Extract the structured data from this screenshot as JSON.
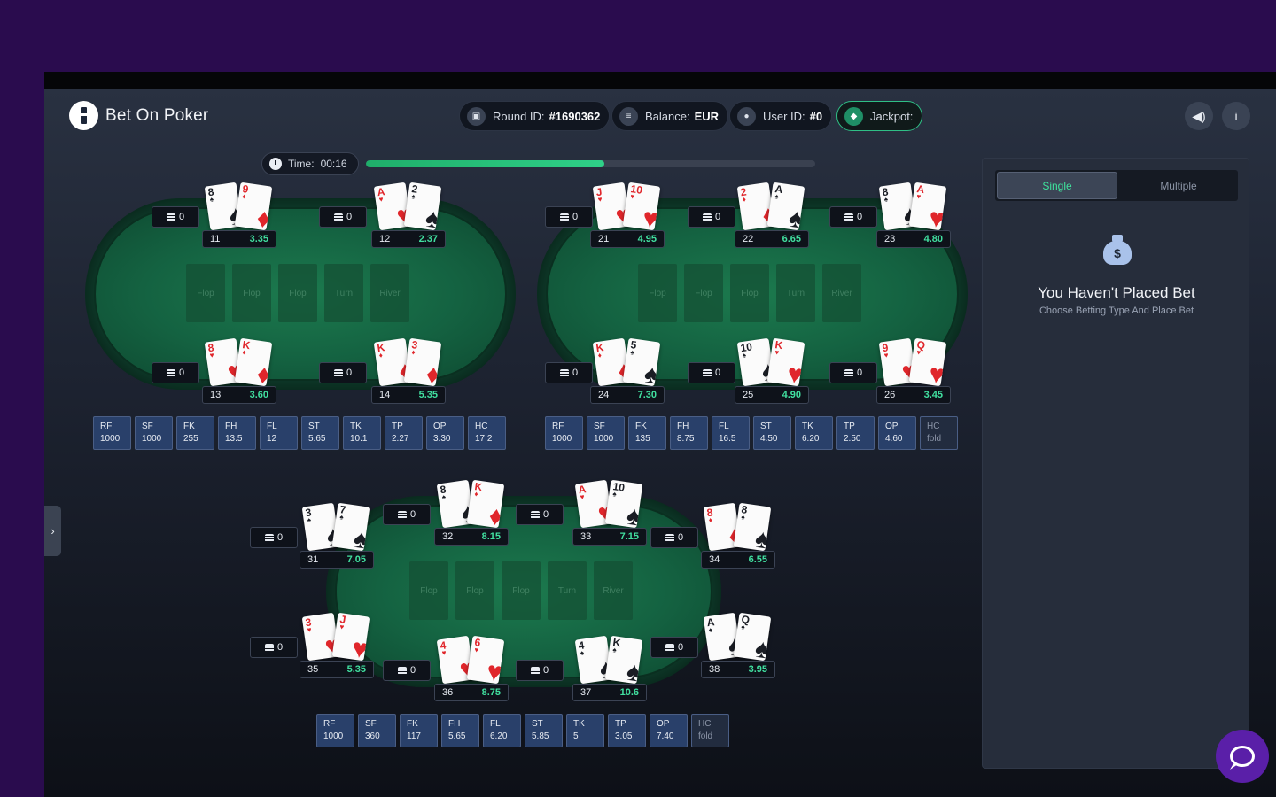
{
  "header": {
    "app_name": "Bet On Poker",
    "round_label": "Round ID:",
    "round_value": "#1690362",
    "balance_label": "Balance:",
    "balance_value": "EUR",
    "user_label": "User ID:",
    "user_value": "#0",
    "jackpot_label": "Jackpot:",
    "sound_icon": "speaker-icon",
    "info_icon": "info-icon"
  },
  "timer": {
    "label": "Time:",
    "value": "00:16",
    "progress_fraction": 0.53
  },
  "slot_labels": [
    "Flop",
    "Flop",
    "Flop",
    "Turn",
    "River"
  ],
  "colors": {
    "accent": "#3fe29d",
    "felt": "#146241",
    "odds_box": "#29406a",
    "brand_bg": "#2a0c4e",
    "chat": "#5a1fa8"
  },
  "tables": [
    {
      "players": [
        {
          "seat": "11",
          "odds": "3.35",
          "chips": "0",
          "cards": [
            {
              "rank": "8",
              "suit": "♠",
              "color": "black"
            },
            {
              "rank": "9",
              "suit": "♦",
              "color": "red"
            }
          ]
        },
        {
          "seat": "12",
          "odds": "2.37",
          "chips": "0",
          "cards": [
            {
              "rank": "A",
              "suit": "♥",
              "color": "red"
            },
            {
              "rank": "2",
              "suit": "♠",
              "color": "black"
            }
          ]
        },
        {
          "seat": "13",
          "odds": "3.60",
          "chips": "0",
          "cards": [
            {
              "rank": "8",
              "suit": "♥",
              "color": "red"
            },
            {
              "rank": "K",
              "suit": "♦",
              "color": "red"
            }
          ]
        },
        {
          "seat": "14",
          "odds": "5.35",
          "chips": "0",
          "cards": [
            {
              "rank": "K",
              "suit": "♦",
              "color": "red"
            },
            {
              "rank": "3",
              "suit": "♦",
              "color": "red"
            }
          ]
        }
      ],
      "odds": [
        {
          "code": "RF",
          "value": "1000"
        },
        {
          "code": "SF",
          "value": "1000"
        },
        {
          "code": "FK",
          "value": "255"
        },
        {
          "code": "FH",
          "value": "13.5"
        },
        {
          "code": "FL",
          "value": "12"
        },
        {
          "code": "ST",
          "value": "5.65"
        },
        {
          "code": "TK",
          "value": "10.1"
        },
        {
          "code": "TP",
          "value": "2.27"
        },
        {
          "code": "OP",
          "value": "3.30"
        },
        {
          "code": "HC",
          "value": "17.2"
        }
      ]
    },
    {
      "players": [
        {
          "seat": "21",
          "odds": "4.95",
          "chips": "0",
          "cards": [
            {
              "rank": "J",
              "suit": "♥",
              "color": "red"
            },
            {
              "rank": "10",
              "suit": "♥",
              "color": "red"
            }
          ]
        },
        {
          "seat": "22",
          "odds": "6.65",
          "chips": "0",
          "cards": [
            {
              "rank": "2",
              "suit": "♦",
              "color": "red"
            },
            {
              "rank": "A",
              "suit": "♠",
              "color": "black"
            }
          ]
        },
        {
          "seat": "23",
          "odds": "4.80",
          "chips": "0",
          "cards": [
            {
              "rank": "8",
              "suit": "♠",
              "color": "black"
            },
            {
              "rank": "A",
              "suit": "♥",
              "color": "red"
            }
          ]
        },
        {
          "seat": "24",
          "odds": "7.30",
          "chips": "0",
          "cards": [
            {
              "rank": "K",
              "suit": "♦",
              "color": "red"
            },
            {
              "rank": "5",
              "suit": "♠",
              "color": "black"
            }
          ]
        },
        {
          "seat": "25",
          "odds": "4.90",
          "chips": "0",
          "cards": [
            {
              "rank": "10",
              "suit": "♠",
              "color": "black"
            },
            {
              "rank": "K",
              "suit": "♥",
              "color": "red"
            }
          ]
        },
        {
          "seat": "26",
          "odds": "3.45",
          "chips": "0",
          "cards": [
            {
              "rank": "9",
              "suit": "♥",
              "color": "red"
            },
            {
              "rank": "Q",
              "suit": "♥",
              "color": "red"
            }
          ]
        }
      ],
      "odds": [
        {
          "code": "RF",
          "value": "1000"
        },
        {
          "code": "SF",
          "value": "1000"
        },
        {
          "code": "FK",
          "value": "135"
        },
        {
          "code": "FH",
          "value": "8.75"
        },
        {
          "code": "FL",
          "value": "16.5"
        },
        {
          "code": "ST",
          "value": "4.50"
        },
        {
          "code": "TK",
          "value": "6.20"
        },
        {
          "code": "TP",
          "value": "2.50"
        },
        {
          "code": "OP",
          "value": "4.60"
        },
        {
          "code": "HC",
          "value": "fold"
        }
      ]
    },
    {
      "players": [
        {
          "seat": "31",
          "odds": "7.05",
          "chips": "0",
          "cards": [
            {
              "rank": "3",
              "suit": "♠",
              "color": "black"
            },
            {
              "rank": "7",
              "suit": "♠",
              "color": "black"
            }
          ]
        },
        {
          "seat": "32",
          "odds": "8.15",
          "chips": "0",
          "cards": [
            {
              "rank": "8",
              "suit": "♠",
              "color": "black"
            },
            {
              "rank": "K",
              "suit": "♦",
              "color": "red"
            }
          ]
        },
        {
          "seat": "33",
          "odds": "7.15",
          "chips": "0",
          "cards": [
            {
              "rank": "A",
              "suit": "♥",
              "color": "red"
            },
            {
              "rank": "10",
              "suit": "♠",
              "color": "black"
            }
          ]
        },
        {
          "seat": "34",
          "odds": "6.55",
          "chips": "0",
          "cards": [
            {
              "rank": "8",
              "suit": "♦",
              "color": "red"
            },
            {
              "rank": "8",
              "suit": "♠",
              "color": "black"
            }
          ]
        },
        {
          "seat": "35",
          "odds": "5.35",
          "chips": "0",
          "cards": [
            {
              "rank": "3",
              "suit": "♥",
              "color": "red"
            },
            {
              "rank": "J",
              "suit": "♥",
              "color": "red"
            }
          ]
        },
        {
          "seat": "36",
          "odds": "8.75",
          "chips": "0",
          "cards": [
            {
              "rank": "4",
              "suit": "♥",
              "color": "red"
            },
            {
              "rank": "6",
              "suit": "♥",
              "color": "red"
            }
          ]
        },
        {
          "seat": "37",
          "odds": "10.6",
          "chips": "0",
          "cards": [
            {
              "rank": "4",
              "suit": "♠",
              "color": "black"
            },
            {
              "rank": "K",
              "suit": "♠",
              "color": "black"
            }
          ]
        },
        {
          "seat": "38",
          "odds": "3.95",
          "chips": "0",
          "cards": [
            {
              "rank": "A",
              "suit": "♠",
              "color": "black"
            },
            {
              "rank": "Q",
              "suit": "♠",
              "color": "black"
            }
          ]
        }
      ],
      "odds": [
        {
          "code": "RF",
          "value": "1000"
        },
        {
          "code": "SF",
          "value": "360"
        },
        {
          "code": "FK",
          "value": "117"
        },
        {
          "code": "FH",
          "value": "5.65"
        },
        {
          "code": "FL",
          "value": "6.20"
        },
        {
          "code": "ST",
          "value": "5.85"
        },
        {
          "code": "TK",
          "value": "5"
        },
        {
          "code": "TP",
          "value": "3.05"
        },
        {
          "code": "OP",
          "value": "7.40"
        },
        {
          "code": "HC",
          "value": "fold"
        }
      ]
    }
  ],
  "bet_panel": {
    "tabs": [
      "Single",
      "Multiple"
    ],
    "active_tab": "Single",
    "bag_symbol": "$",
    "title": "You Haven't Placed Bet",
    "subtitle": "Choose Betting Type And Place Bet"
  }
}
